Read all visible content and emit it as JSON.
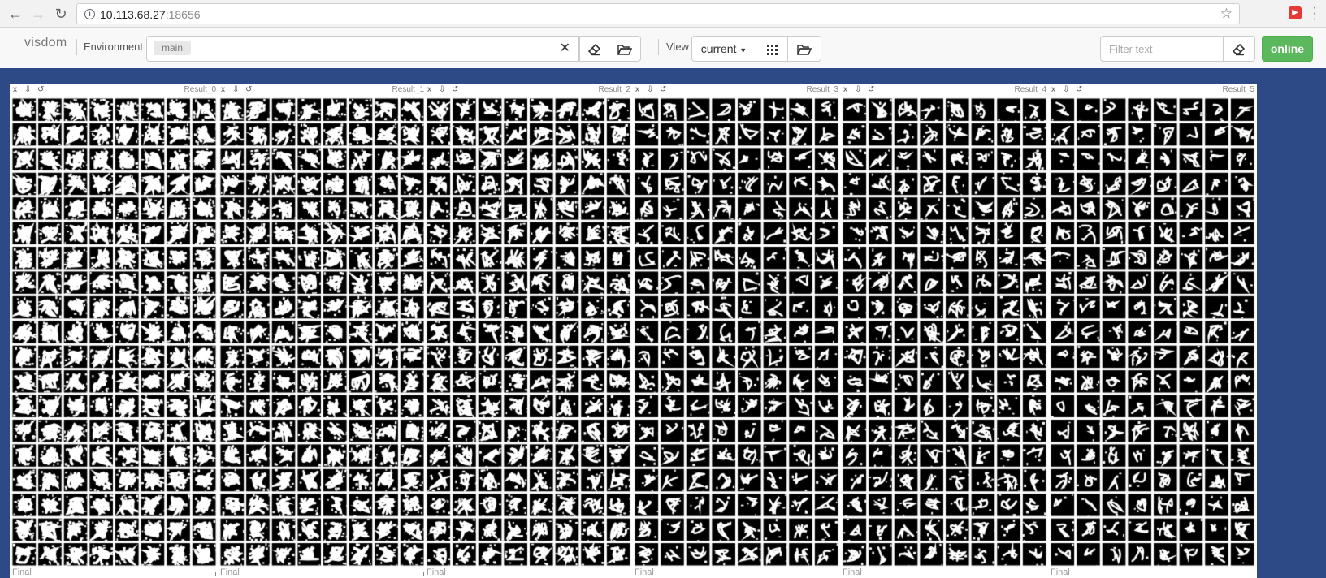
{
  "browser": {
    "url_host": "10.113.68.27",
    "url_port": ":18656"
  },
  "toolbar": {
    "brand": "visdom",
    "environment_label": "Environment",
    "environment_chip": "main",
    "view_label": "View",
    "view_selected": "current",
    "filter_placeholder": "Filter text",
    "online_label": "online"
  },
  "icons": {
    "back": "arrow-left-icon",
    "forward": "arrow-right-icon",
    "reload": "reload-icon",
    "info": "info-icon",
    "bookmark": "star-icon",
    "extension": "extension-icon",
    "menu": "kebab-menu-icon",
    "env_clear": "close-icon",
    "env_eraser": "eraser-icon",
    "env_folder": "folder-open-icon",
    "view_grid": "grid-icon",
    "view_folder": "folder-open-icon",
    "filter_eraser": "eraser-icon",
    "pane_close": "close-icon",
    "pane_download": "download-icon",
    "pane_reset": "reset-icon"
  },
  "colors": {
    "workspace_bg": "#2e4a86",
    "online_green": "#5cb85c"
  },
  "panes": [
    {
      "title": "Result_0",
      "caption": "Final"
    },
    {
      "title": "Result_1",
      "caption": "Final"
    },
    {
      "title": "Result_2",
      "caption": "Final"
    },
    {
      "title": "Result_3",
      "caption": "Final"
    },
    {
      "title": "Result_4",
      "caption": "Final"
    },
    {
      "title": "Result_5",
      "caption": "Final"
    }
  ]
}
